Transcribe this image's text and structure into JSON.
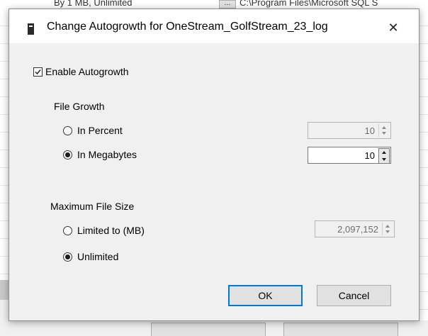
{
  "background": {
    "row_text_left": "By 1 MB, Unlimited",
    "ellipsis_label": "...",
    "row_text_right": "C:\\Program Files\\Microsoft SQL S"
  },
  "dialog": {
    "title": "Change Autogrowth for OneStream_GolfStream_23_log",
    "close_glyph": "✕",
    "enable_autogrowth": {
      "label": "Enable Autogrowth",
      "checked": true
    },
    "file_growth": {
      "heading": "File Growth",
      "percent": {
        "label": "In Percent",
        "selected": false,
        "value": "10",
        "enabled": false
      },
      "megabytes": {
        "label": "In Megabytes",
        "selected": true,
        "value": "10",
        "enabled": true
      }
    },
    "max_file_size": {
      "heading": "Maximum File Size",
      "limited": {
        "label": "Limited to (MB)",
        "selected": false,
        "value": "2,097,152",
        "enabled": false
      },
      "unlimited": {
        "label": "Unlimited",
        "selected": true
      }
    },
    "buttons": {
      "ok": "OK",
      "cancel": "Cancel"
    }
  },
  "colors": {
    "accent": "#0078d7",
    "dialog_bg": "#f0f0f0",
    "titlebar_bg": "#ffffff"
  },
  "icons": {
    "title_icon": "database-file-icon",
    "close_icon": "close-icon"
  }
}
